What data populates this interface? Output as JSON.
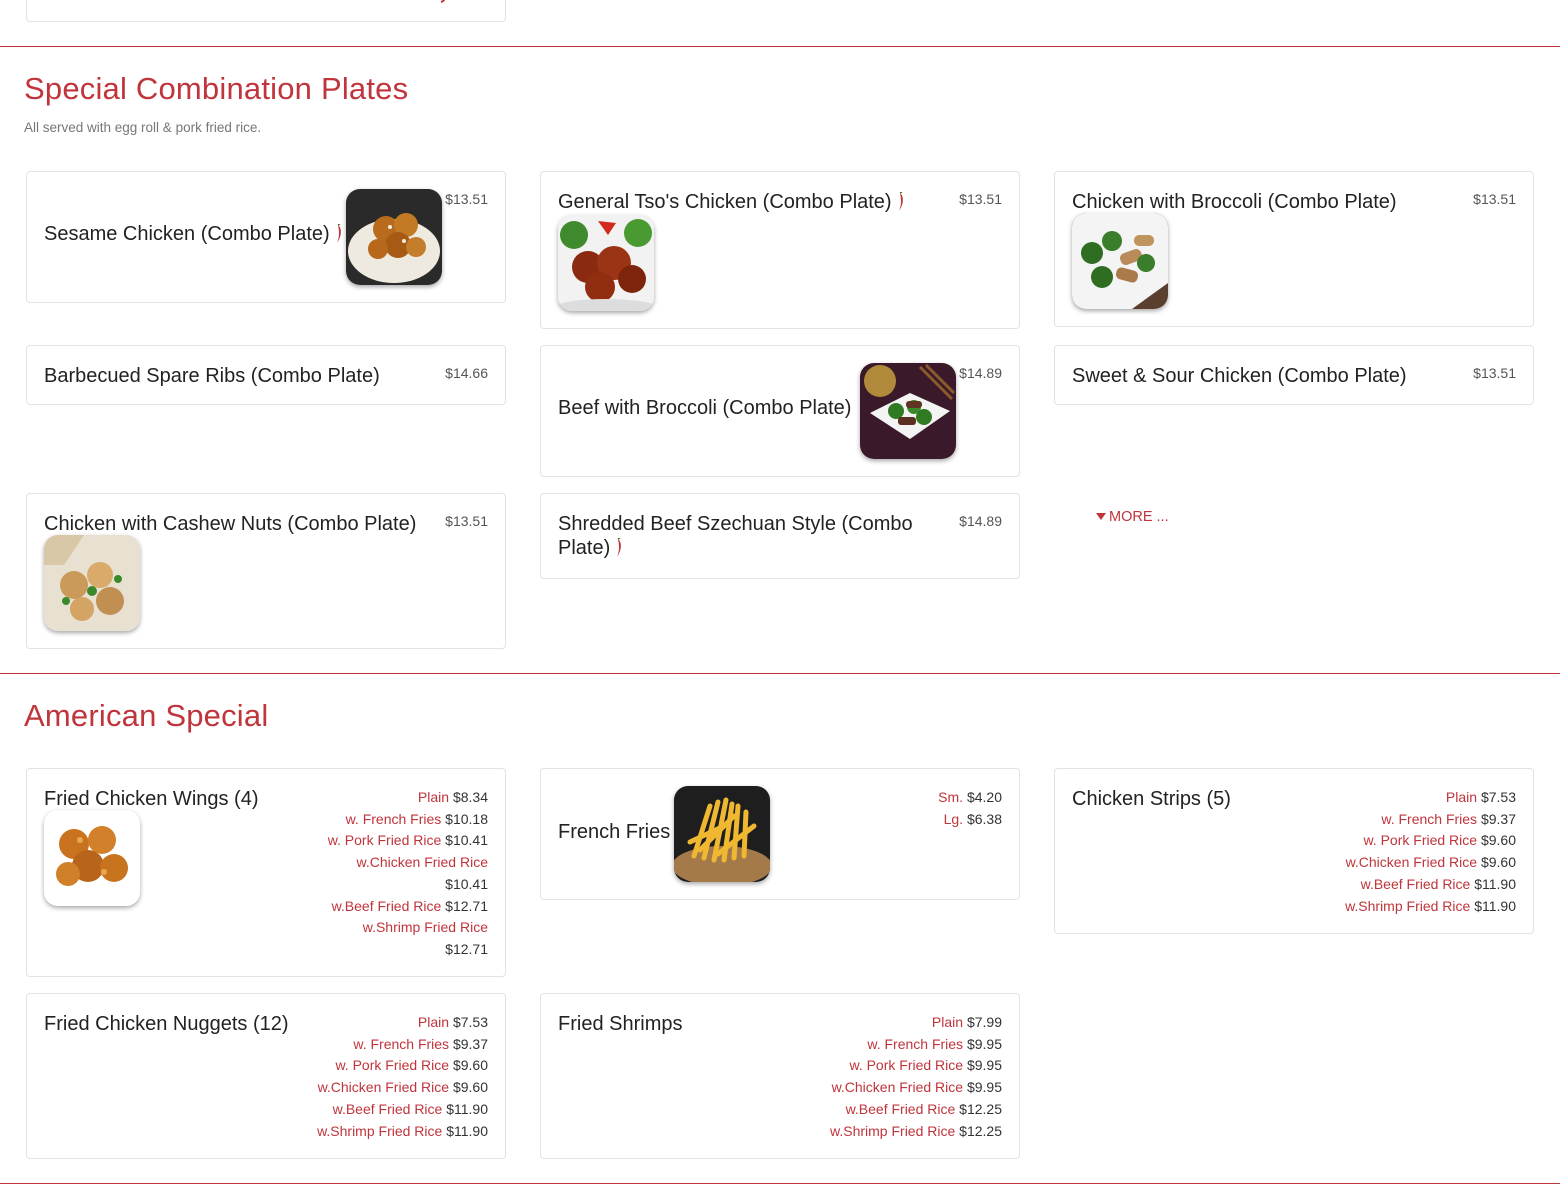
{
  "sections": {
    "combo": {
      "title": "Special Combination Plates",
      "subtitle": "All served with egg roll & pork fried rice.",
      "items": [
        {
          "name": "Sesame Chicken (Combo Plate)",
          "price": "$13.51"
        },
        {
          "name": "General Tso's Chicken (Combo Plate)",
          "price": "$13.51"
        },
        {
          "name": "Chicken with Broccoli (Combo Plate)",
          "price": "$13.51"
        },
        {
          "name": "Barbecued Spare Ribs (Combo Plate)",
          "price": "$14.66"
        },
        {
          "name": "Beef with Broccoli (Combo Plate)",
          "price": "$14.89"
        },
        {
          "name": "Sweet & Sour Chicken (Combo Plate)",
          "price": "$13.51"
        },
        {
          "name": "Chicken with Cashew Nuts (Combo Plate)",
          "price": "$13.51"
        },
        {
          "name": "Shredded Beef Szechuan Style (Combo Plate)",
          "price": "$14.89"
        }
      ],
      "more_label": "MORE ..."
    },
    "american": {
      "title": "American Special",
      "items": [
        {
          "name": "Fried Chicken Wings (4)",
          "options": [
            {
              "label": "Plain",
              "price": "$8.34"
            },
            {
              "label": "w. French Fries",
              "price": "$10.18"
            },
            {
              "label": "w. Pork Fried Rice",
              "price": "$10.41"
            },
            {
              "label": "w.Chicken Fried Rice",
              "price": "$10.41"
            },
            {
              "label": "w.Beef Fried Rice",
              "price": "$12.71"
            },
            {
              "label": "w.Shrimp Fried Rice",
              "price": "$12.71"
            }
          ]
        },
        {
          "name": "French Fries",
          "options": [
            {
              "label": "Sm.",
              "price": "$4.20"
            },
            {
              "label": "Lg.",
              "price": "$6.38"
            }
          ]
        },
        {
          "name": "Chicken Strips (5)",
          "options": [
            {
              "label": "Plain",
              "price": "$7.53"
            },
            {
              "label": "w. French Fries",
              "price": "$9.37"
            },
            {
              "label": "w. Pork Fried Rice",
              "price": "$9.60"
            },
            {
              "label": "w.Chicken Fried Rice",
              "price": "$9.60"
            },
            {
              "label": "w.Beef Fried Rice",
              "price": "$11.90"
            },
            {
              "label": "w.Shrimp Fried Rice",
              "price": "$11.90"
            }
          ]
        },
        {
          "name": "Fried Chicken Nuggets (12)",
          "options": [
            {
              "label": "Plain",
              "price": "$7.53"
            },
            {
              "label": "w. French Fries",
              "price": "$9.37"
            },
            {
              "label": "w. Pork Fried Rice",
              "price": "$9.60"
            },
            {
              "label": "w.Chicken Fried Rice",
              "price": "$9.60"
            },
            {
              "label": "w.Beef Fried Rice",
              "price": "$11.90"
            },
            {
              "label": "w.Shrimp Fried Rice",
              "price": "$11.90"
            }
          ]
        },
        {
          "name": "Fried Shrimps",
          "options": [
            {
              "label": "Plain",
              "price": "$7.99"
            },
            {
              "label": "w. French Fries",
              "price": "$9.95"
            },
            {
              "label": "w. Pork Fried Rice",
              "price": "$9.95"
            },
            {
              "label": "w.Chicken Fried Rice",
              "price": "$9.95"
            },
            {
              "label": "w.Beef Fried Rice",
              "price": "$12.25"
            },
            {
              "label": "w.Shrimp Fried Rice",
              "price": "$12.25"
            }
          ]
        }
      ]
    }
  },
  "icons": {
    "spicy": "chili-pepper-icon",
    "more": "caret-down-icon"
  },
  "colors": {
    "accent": "#c0343b",
    "border": "#e2e2e2",
    "text": "#222222",
    "muted": "#777777"
  }
}
